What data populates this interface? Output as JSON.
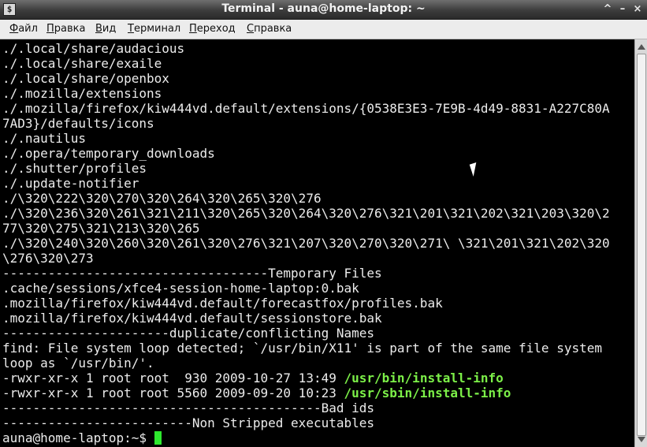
{
  "window": {
    "title": "Terminal - auna@home-laptop: ~",
    "icon_glyph": "$",
    "buttons": [
      "^",
      "–",
      "×"
    ]
  },
  "menu": [
    "Файл",
    "Правка",
    "Вид",
    "Терминал",
    "Переход",
    "Справка"
  ],
  "terminal": {
    "lines": [
      "./.local/share/audacious",
      "./.local/share/exaile",
      "./.local/share/openbox",
      "./.mozilla/extensions",
      "./.mozilla/firefox/kiw444vd.default/extensions/{0538E3E3-7E9B-4d49-8831-A227C80A",
      "7AD3}/defaults/icons",
      "./.nautilus",
      "./.opera/temporary_downloads",
      "./.shutter/profiles",
      "./.update-notifier",
      "./\\320\\222\\320\\270\\320\\264\\320\\265\\320\\276",
      "./\\320\\236\\320\\261\\321\\211\\320\\265\\320\\264\\320\\276\\321\\201\\321\\202\\321\\203\\320\\2",
      "77\\320\\275\\321\\213\\320\\265",
      "./\\320\\240\\320\\260\\320\\261\\320\\276\\321\\207\\320\\270\\320\\271\\ \\321\\201\\321\\202\\320",
      "\\276\\320\\273",
      "-----------------------------------Temporary Files",
      ".cache/sessions/xfce4-session-home-laptop:0.bak",
      ".mozilla/firefox/kiw444vd.default/forecastfox/profiles.bak",
      ".mozilla/firefox/kiw444vd.default/sessionstore.bak",
      "----------------------duplicate/conflicting Names",
      "find: File system loop detected; `/usr/bin/X11' is part of the same file system",
      "loop as `/usr/bin/'.",
      {
        "prefix": "-rwxr-xr-x 1 root root  930 2009-10-27 13:49 ",
        "link": "/usr/bin/install-info"
      },
      {
        "prefix": "-rwxr-xr-x 1 root root 5560 2009-09-20 10:23 ",
        "link": "/usr/sbin/install-info"
      },
      "------------------------------------------Bad ids",
      "-------------------------Non Stripped executables"
    ],
    "prompt": "auna@home-laptop:~$ "
  },
  "colors": {
    "background": "#000000",
    "text": "#ececec",
    "link": "#7cf048",
    "cursor": "#2ee82e"
  }
}
